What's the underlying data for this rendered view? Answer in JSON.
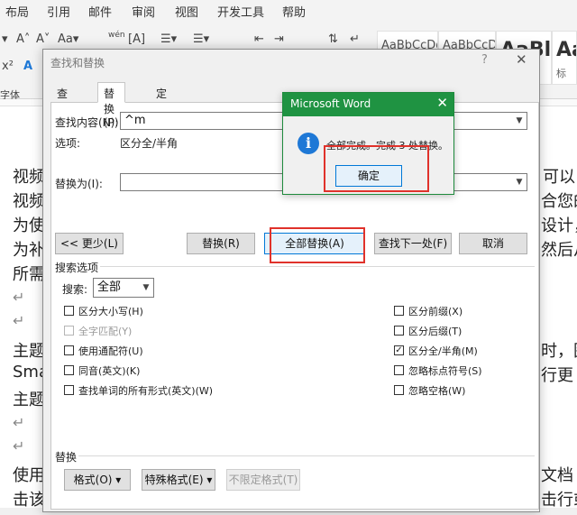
{
  "menubar": {
    "items": [
      "布局",
      "引用",
      "邮件",
      "审阅",
      "视图",
      "开发工具",
      "帮助"
    ]
  },
  "ribbon": {
    "styles": [
      {
        "sample": "AaBbCcDd",
        "name": ""
      },
      {
        "sample": "AaBbCcDd",
        "name": ""
      },
      {
        "sample": "AaBl",
        "name": ""
      },
      {
        "sample": "Aa",
        "name": "标"
      }
    ],
    "font_group_label": "字体"
  },
  "document": {
    "lines": [
      "视频",
      "视频",
      "为使",
      "为补",
      "所需",
      "主题",
      "Sma",
      "主题",
      "使用",
      "击该"
    ],
    "right_fragments": [
      "可以",
      "合您的",
      "设计，",
      "然后从",
      "时，图",
      "行更",
      "文档",
      "击行或"
    ]
  },
  "dialog": {
    "title": "查找和替换",
    "help_glyph": "?",
    "close_glyph": "✕",
    "tabs": [
      "查找(D)",
      "替换(P)",
      "定位(G)"
    ],
    "active_tab": 1,
    "find_label": "查找内容(N):",
    "find_value": "^m",
    "options_label": "选项:",
    "options_value": "区分全/半角",
    "replace_label": "替换为(I):",
    "replace_value": "",
    "buttons": {
      "less": "<< 更少(L)",
      "replace": "替换(R)",
      "replace_all": "全部替换(A)",
      "find_next": "查找下一处(F)",
      "cancel": "取消"
    },
    "search_options_title": "搜索选项",
    "search_label": "搜索:",
    "search_value": "全部",
    "left_checks": [
      {
        "label": "区分大小写(H)",
        "checked": false,
        "disabled": false
      },
      {
        "label": "全字匹配(Y)",
        "checked": false,
        "disabled": true
      },
      {
        "label": "使用通配符(U)",
        "checked": false,
        "disabled": false
      },
      {
        "label": "同音(英文)(K)",
        "checked": false,
        "disabled": false
      },
      {
        "label": "查找单词的所有形式(英文)(W)",
        "checked": false,
        "disabled": false
      }
    ],
    "right_checks": [
      {
        "label": "区分前缀(X)",
        "checked": false,
        "disabled": false
      },
      {
        "label": "区分后缀(T)",
        "checked": false,
        "disabled": false
      },
      {
        "label": "区分全/半角(M)",
        "checked": true,
        "disabled": false
      },
      {
        "label": "忽略标点符号(S)",
        "checked": false,
        "disabled": false
      },
      {
        "label": "忽略空格(W)",
        "checked": false,
        "disabled": false
      }
    ],
    "replace_section_title": "替换",
    "bottom_buttons": [
      "格式(O) ▾",
      "特殊格式(E) ▾",
      "不限定格式(T)"
    ]
  },
  "msgbox": {
    "title": "Microsoft Word",
    "message": "全部完成。完成 3 处替换。",
    "ok_label": "确定",
    "close_glyph": "✕",
    "icon_glyph": "i"
  },
  "colors": {
    "msgbox_titlebar": "#1f9342",
    "highlight": "#e0322b",
    "info_icon": "#1e78d6"
  }
}
